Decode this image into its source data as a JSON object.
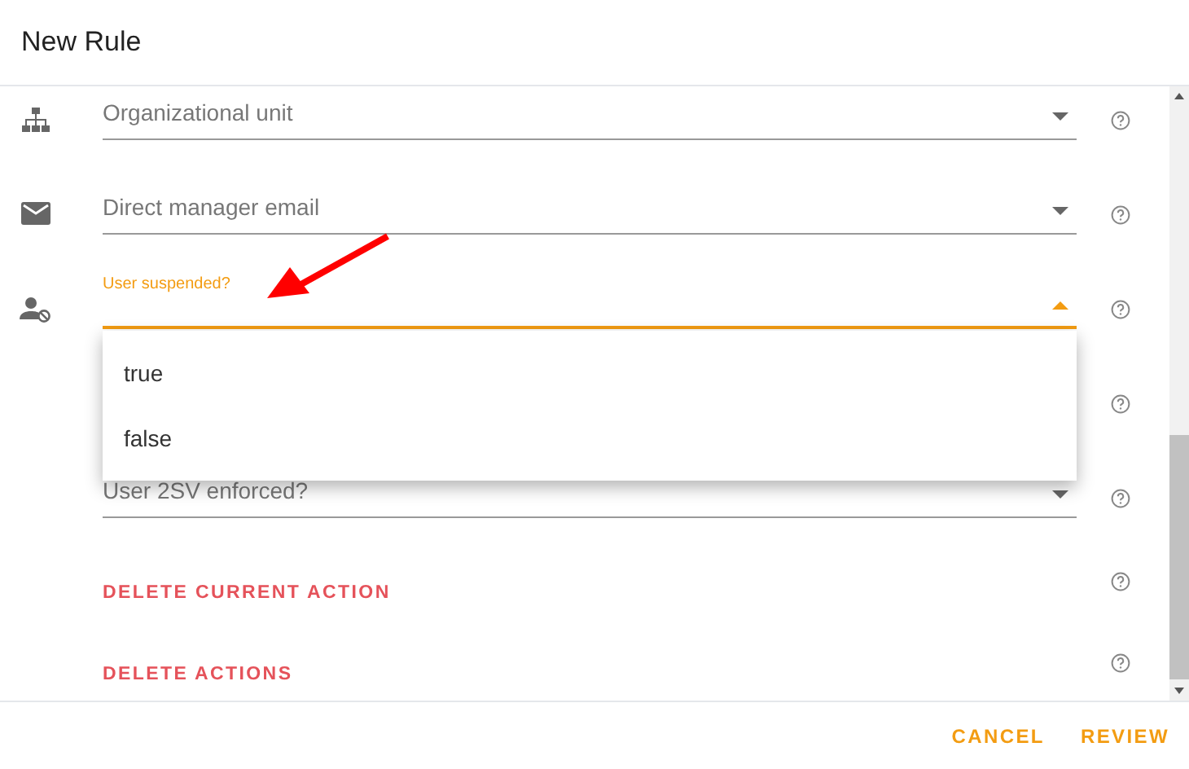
{
  "dialog": {
    "title": "New Rule"
  },
  "rows": [
    {
      "kind": "select",
      "label": "Organizational unit",
      "open": false
    },
    {
      "kind": "select",
      "label": "Direct manager email",
      "open": false
    },
    {
      "kind": "select",
      "label": "User suspended?",
      "open": true
    },
    {
      "kind": "covered"
    },
    {
      "kind": "select",
      "label": "User 2SV enforced?",
      "open": false
    }
  ],
  "menu": {
    "options": [
      {
        "label": "true",
        "selected": false
      },
      {
        "label": "false",
        "selected": false
      }
    ]
  },
  "actions": [
    "DELETE CURRENT ACTION",
    "DELETE ACTIONS"
  ],
  "footer_buttons": [
    "CANCEL",
    "REVIEW"
  ]
}
